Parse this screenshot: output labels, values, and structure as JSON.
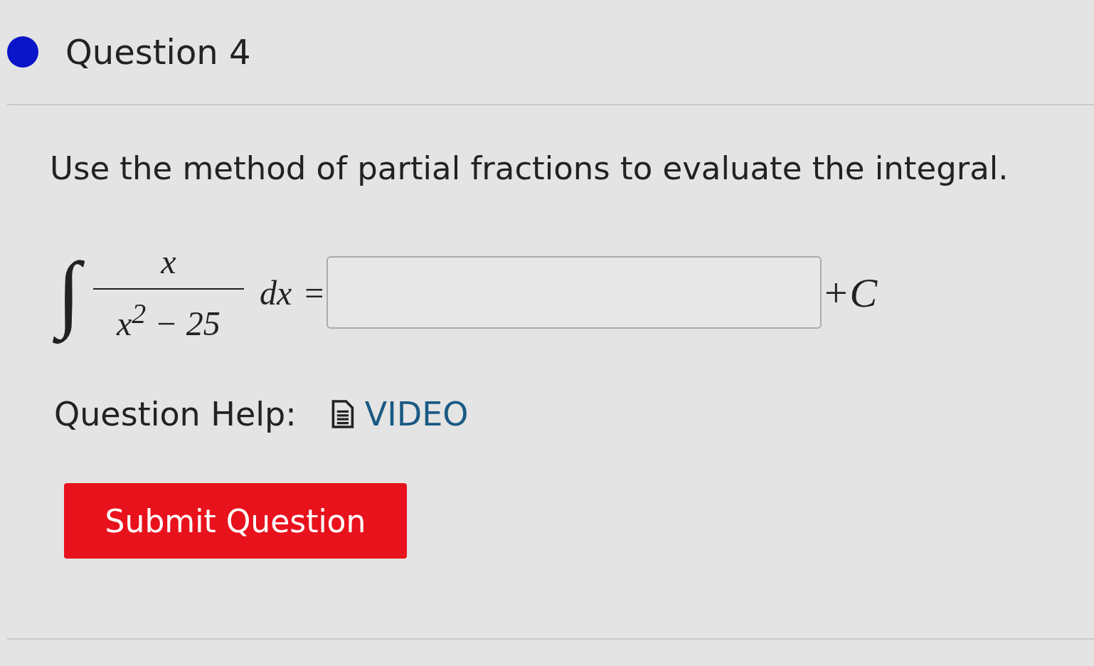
{
  "question": {
    "title": "Question 4"
  },
  "prompt": "Use the method of partial fractions to evaluate the integral.",
  "equation": {
    "integral_sign": "∫",
    "numerator": "x",
    "denominator": "x$^{2}$ − 25",
    "differential": "dx",
    "equals": "=",
    "suffix": "+C"
  },
  "help": {
    "label": "Question Help:",
    "links": [
      {
        "label": "VIDEO"
      }
    ]
  },
  "submit_button": "Submit Question"
}
